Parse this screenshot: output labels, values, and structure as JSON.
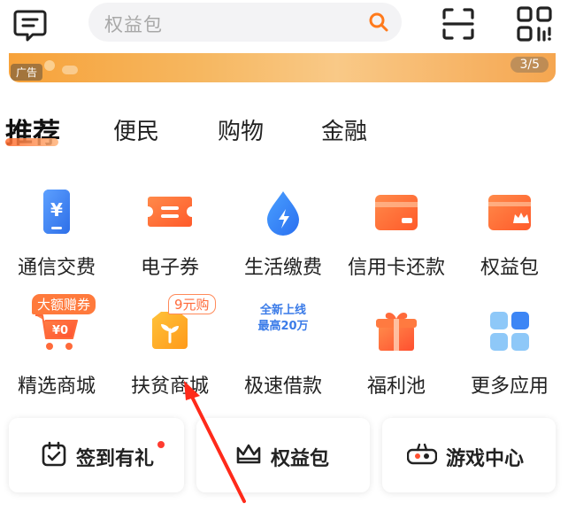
{
  "search": {
    "placeholder": "权益包"
  },
  "banner": {
    "ad_tag": "广告",
    "page_indicator": "3/5"
  },
  "tabs": [
    {
      "label": "推荐",
      "active": true
    },
    {
      "label": "便民"
    },
    {
      "label": "购物"
    },
    {
      "label": "金融"
    }
  ],
  "grid": {
    "row1": [
      {
        "label": "通信交费",
        "icon": "phone-yen-icon"
      },
      {
        "label": "电子券",
        "icon": "coupon-icon"
      },
      {
        "label": "生活缴费",
        "icon": "water-drop-bolt-icon"
      },
      {
        "label": "信用卡还款",
        "icon": "credit-card-icon"
      },
      {
        "label": "权益包",
        "icon": "crown-card-icon"
      }
    ],
    "row2": [
      {
        "label": "精选商城",
        "icon": "shopping-cart-icon",
        "badge": "大额赠券"
      },
      {
        "label": "扶贫商城",
        "icon": "sprout-bag-icon",
        "badge": "9元购"
      },
      {
        "label": "极速借款",
        "promo_line1": "全新上线",
        "promo_line2": "最高20万"
      },
      {
        "label": "福利池",
        "icon": "gift-box-icon"
      },
      {
        "label": "更多应用",
        "icon": "app-grid-icon"
      }
    ]
  },
  "cards": [
    {
      "label": "签到有礼",
      "icon": "calendar-check-icon"
    },
    {
      "label": "权益包",
      "icon": "crown-icon"
    },
    {
      "label": "游戏中心",
      "icon": "game-controller-icon"
    }
  ],
  "colors": {
    "accent": "#ff6a2c",
    "blue": "#3a7be8",
    "orange": "#ff7a3c"
  }
}
